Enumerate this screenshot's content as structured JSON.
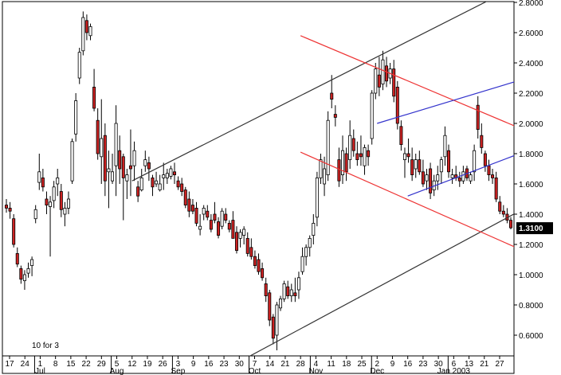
{
  "chart_data": {
    "type": "candlestick",
    "title": "",
    "ylim": [
      0.5,
      2.8
    ],
    "y_ticks": [
      "2.8000",
      "2.6000",
      "2.4000",
      "2.2000",
      "2.0000",
      "1.8000",
      "1.6000",
      "1.4000",
      "1.2000",
      "1.0000",
      "0.8000",
      "0.6000"
    ],
    "y_tick_values": [
      2.8,
      2.6,
      2.4,
      2.2,
      2.0,
      1.8,
      1.6,
      1.4,
      1.2,
      1.0,
      0.8,
      0.6
    ],
    "x_ticks": [
      "17",
      "24",
      "1",
      "8",
      "15",
      "22",
      "29",
      "5",
      "12",
      "19",
      "26",
      "3",
      "9",
      "16",
      "23",
      "30",
      "7",
      "14",
      "21",
      "28",
      "4",
      "11",
      "18",
      "25",
      "2",
      "9",
      "16",
      "23",
      "30",
      "6",
      "13",
      "21",
      "27"
    ],
    "month_labels": [
      "Jul",
      "Aug",
      "Sep",
      "Oct",
      "Nov",
      "Dec",
      "Jan 2003"
    ],
    "month_label_tick_index": [
      2,
      7,
      11,
      16,
      20,
      24,
      29
    ],
    "last_price": "1.3100",
    "last_price_value": 1.31,
    "annotation": "10 for 3",
    "colors": {
      "up": "#ffffff",
      "down": "#cc2222",
      "outline": "#000000",
      "channel_black": "#333333",
      "channel_red": "#ee3333",
      "channel_blue": "#3333cc",
      "price_tag_bg": "#000000"
    },
    "candles": [
      [
        1.46,
        1.5,
        1.41,
        1.44
      ],
      [
        1.44,
        1.48,
        1.37,
        1.42
      ],
      [
        1.37,
        1.4,
        1.18,
        1.2
      ],
      [
        1.14,
        1.18,
        1.05,
        1.07
      ],
      [
        1.04,
        1.06,
        0.94,
        0.97
      ],
      [
        0.96,
        1.03,
        0.9,
        1.0
      ],
      [
        1.01,
        1.08,
        0.98,
        1.04
      ],
      [
        1.06,
        1.12,
        0.99,
        1.1
      ],
      [
        1.37,
        1.46,
        1.34,
        1.43
      ],
      [
        1.61,
        1.8,
        1.56,
        1.68
      ],
      [
        1.64,
        1.7,
        1.55,
        1.58
      ],
      [
        1.5,
        1.55,
        1.4,
        1.46
      ],
      [
        1.45,
        1.52,
        1.12,
        1.48
      ],
      [
        1.49,
        1.62,
        1.44,
        1.58
      ],
      [
        1.6,
        1.7,
        1.52,
        1.64
      ],
      [
        1.55,
        1.6,
        1.38,
        1.43
      ],
      [
        1.4,
        1.48,
        1.32,
        1.44
      ],
      [
        1.44,
        1.55,
        1.4,
        1.5
      ],
      [
        1.62,
        1.9,
        1.6,
        1.88
      ],
      [
        1.93,
        2.2,
        1.88,
        2.15
      ],
      [
        2.3,
        2.5,
        2.26,
        2.47
      ],
      [
        2.48,
        2.74,
        2.45,
        2.7
      ],
      [
        2.68,
        2.72,
        2.55,
        2.6
      ],
      [
        2.58,
        2.66,
        2.55,
        2.64
      ],
      [
        2.24,
        2.36,
        2.08,
        2.1
      ],
      [
        2.02,
        2.1,
        1.76,
        1.8
      ],
      [
        1.78,
        2.16,
        1.6,
        1.9
      ],
      [
        1.92,
        2.0,
        1.52,
        1.62
      ],
      [
        1.68,
        1.82,
        1.44,
        1.7
      ],
      [
        1.62,
        1.8,
        1.6,
        1.68
      ],
      [
        1.72,
        2.12,
        1.52,
        2.0
      ],
      [
        1.82,
        1.92,
        1.6,
        1.7
      ],
      [
        1.78,
        1.8,
        1.36,
        1.64
      ],
      [
        1.62,
        1.7,
        1.5,
        1.66
      ],
      [
        1.72,
        1.96,
        1.52,
        1.7
      ],
      [
        1.72,
        1.88,
        1.62,
        1.82
      ],
      [
        1.58,
        1.62,
        1.48,
        1.52
      ],
      [
        1.56,
        1.7,
        1.55,
        1.64
      ],
      [
        1.72,
        1.82,
        1.68,
        1.76
      ],
      [
        1.74,
        1.78,
        1.62,
        1.7
      ],
      [
        1.64,
        1.66,
        1.52,
        1.58
      ],
      [
        1.6,
        1.68,
        1.58,
        1.62
      ],
      [
        1.56,
        1.66,
        1.55,
        1.6
      ],
      [
        1.64,
        1.74,
        1.56,
        1.66
      ],
      [
        1.64,
        1.7,
        1.6,
        1.67
      ],
      [
        1.65,
        1.72,
        1.63,
        1.7
      ],
      [
        1.68,
        1.74,
        1.6,
        1.66
      ],
      [
        1.62,
        1.65,
        1.56,
        1.58
      ],
      [
        1.6,
        1.64,
        1.52,
        1.55
      ],
      [
        1.56,
        1.58,
        1.44,
        1.46
      ],
      [
        1.5,
        1.55,
        1.38,
        1.42
      ],
      [
        1.46,
        1.5,
        1.4,
        1.42
      ],
      [
        1.44,
        1.48,
        1.32,
        1.34
      ],
      [
        1.3,
        1.4,
        1.26,
        1.32
      ],
      [
        1.4,
        1.46,
        1.36,
        1.44
      ],
      [
        1.42,
        1.46,
        1.36,
        1.38
      ],
      [
        1.36,
        1.4,
        1.28,
        1.3
      ],
      [
        1.4,
        1.48,
        1.34,
        1.36
      ],
      [
        1.35,
        1.38,
        1.24,
        1.26
      ],
      [
        1.32,
        1.44,
        1.3,
        1.42
      ],
      [
        1.4,
        1.44,
        1.34,
        1.36
      ],
      [
        1.34,
        1.36,
        1.28,
        1.3
      ],
      [
        1.36,
        1.42,
        1.24,
        1.24
      ],
      [
        1.28,
        1.32,
        1.14,
        1.16
      ],
      [
        1.24,
        1.3,
        1.18,
        1.28
      ],
      [
        1.26,
        1.32,
        1.2,
        1.3
      ],
      [
        1.24,
        1.28,
        1.12,
        1.14
      ],
      [
        1.18,
        1.24,
        1.1,
        1.12
      ],
      [
        1.12,
        1.16,
        1.04,
        1.06
      ],
      [
        1.1,
        1.14,
        1.0,
        1.02
      ],
      [
        1.04,
        1.08,
        0.96,
        0.98
      ],
      [
        0.94,
        0.98,
        0.82,
        0.86
      ],
      [
        0.88,
        0.9,
        0.66,
        0.7
      ],
      [
        0.72,
        0.74,
        0.54,
        0.58
      ],
      [
        0.6,
        0.82,
        0.5,
        0.8
      ],
      [
        0.78,
        0.86,
        0.76,
        0.84
      ],
      [
        0.84,
        0.96,
        0.82,
        0.94
      ],
      [
        0.92,
        0.96,
        0.84,
        0.86
      ],
      [
        0.86,
        0.94,
        0.82,
        0.9
      ],
      [
        0.88,
        0.98,
        0.82,
        0.86
      ],
      [
        0.9,
        1.02,
        0.84,
        0.98
      ],
      [
        1.02,
        1.18,
        1.0,
        1.12
      ],
      [
        1.12,
        1.2,
        1.06,
        1.18
      ],
      [
        1.18,
        1.26,
        1.12,
        1.24
      ],
      [
        1.26,
        1.4,
        1.2,
        1.34
      ],
      [
        1.38,
        1.68,
        1.32,
        1.64
      ],
      [
        1.64,
        1.8,
        1.6,
        1.76
      ],
      [
        1.6,
        1.78,
        1.52,
        1.7
      ],
      [
        1.66,
        2.08,
        1.62,
        2.02
      ],
      [
        2.2,
        2.32,
        2.1,
        2.16
      ],
      [
        2.06,
        2.12,
        1.98,
        2.04
      ],
      [
        1.76,
        1.84,
        1.58,
        1.62
      ],
      [
        1.66,
        1.92,
        1.6,
        1.82
      ],
      [
        1.8,
        1.84,
        1.62,
        1.68
      ],
      [
        1.76,
        2.02,
        1.7,
        1.92
      ],
      [
        1.9,
        1.96,
        1.78,
        1.82
      ],
      [
        1.8,
        1.88,
        1.72,
        1.76
      ],
      [
        1.8,
        1.92,
        1.72,
        1.78
      ],
      [
        1.72,
        1.86,
        1.66,
        1.84
      ],
      [
        1.82,
        1.86,
        1.72,
        1.78
      ],
      [
        1.9,
        2.22,
        1.86,
        2.2
      ],
      [
        2.2,
        2.4,
        2.16,
        2.36
      ],
      [
        2.32,
        2.44,
        2.18,
        2.24
      ],
      [
        2.26,
        2.48,
        2.22,
        2.42
      ],
      [
        2.38,
        2.44,
        2.24,
        2.28
      ],
      [
        2.3,
        2.4,
        2.26,
        2.36
      ],
      [
        2.36,
        2.42,
        2.14,
        2.18
      ],
      [
        2.24,
        2.28,
        1.96,
        2.0
      ],
      [
        1.98,
        2.02,
        1.82,
        1.86
      ],
      [
        1.76,
        1.84,
        1.64,
        1.8
      ],
      [
        1.8,
        1.9,
        1.74,
        1.78
      ],
      [
        1.76,
        1.84,
        1.62,
        1.66
      ],
      [
        1.7,
        1.8,
        1.64,
        1.76
      ],
      [
        1.76,
        1.82,
        1.66,
        1.68
      ],
      [
        1.68,
        1.76,
        1.58,
        1.6
      ],
      [
        1.62,
        1.7,
        1.56,
        1.66
      ],
      [
        1.7,
        1.74,
        1.5,
        1.54
      ],
      [
        1.56,
        1.66,
        1.52,
        1.62
      ],
      [
        1.62,
        1.72,
        1.56,
        1.66
      ],
      [
        1.68,
        1.78,
        1.6,
        1.76
      ],
      [
        1.78,
        1.98,
        1.72,
        1.92
      ],
      [
        1.82,
        1.86,
        1.64,
        1.68
      ],
      [
        1.64,
        1.7,
        1.6,
        1.66
      ],
      [
        1.66,
        1.72,
        1.62,
        1.64
      ],
      [
        1.64,
        1.68,
        1.58,
        1.62
      ],
      [
        1.62,
        1.72,
        1.6,
        1.68
      ],
      [
        1.7,
        1.72,
        1.62,
        1.64
      ],
      [
        1.62,
        1.68,
        1.6,
        1.66
      ],
      [
        1.68,
        1.86,
        1.62,
        1.82
      ],
      [
        2.12,
        2.18,
        1.9,
        1.96
      ],
      [
        1.92,
        2.0,
        1.8,
        1.84
      ],
      [
        1.8,
        1.82,
        1.68,
        1.72
      ],
      [
        1.72,
        1.76,
        1.62,
        1.66
      ],
      [
        1.66,
        1.7,
        1.6,
        1.64
      ],
      [
        1.64,
        1.68,
        1.48,
        1.5
      ],
      [
        1.48,
        1.52,
        1.4,
        1.42
      ],
      [
        1.42,
        1.46,
        1.38,
        1.4
      ],
      [
        1.4,
        1.44,
        1.34,
        1.36
      ],
      [
        1.36,
        1.38,
        1.3,
        1.31
      ]
    ],
    "trendlines": [
      {
        "color": "black",
        "points": [
          [
            "2002-08-12",
            1.62
          ],
          [
            "2003-01-27",
            2.85
          ]
        ]
      },
      {
        "color": "black",
        "points": [
          [
            "2002-10-02",
            0.44
          ],
          [
            "2003-02-05",
            1.42
          ]
        ]
      },
      {
        "color": "red",
        "points": [
          [
            "2002-10-28",
            2.58
          ],
          [
            "2003-02-05",
            1.97
          ]
        ]
      },
      {
        "color": "red",
        "points": [
          [
            "2002-10-28",
            1.81
          ],
          [
            "2003-02-05",
            1.17
          ]
        ]
      },
      {
        "color": "blue",
        "points": [
          [
            "2002-12-02",
            2.0
          ],
          [
            "2003-02-04",
            2.28
          ]
        ]
      },
      {
        "color": "blue",
        "points": [
          [
            "2002-12-16",
            1.52
          ],
          [
            "2003-02-05",
            1.8
          ]
        ]
      }
    ]
  }
}
